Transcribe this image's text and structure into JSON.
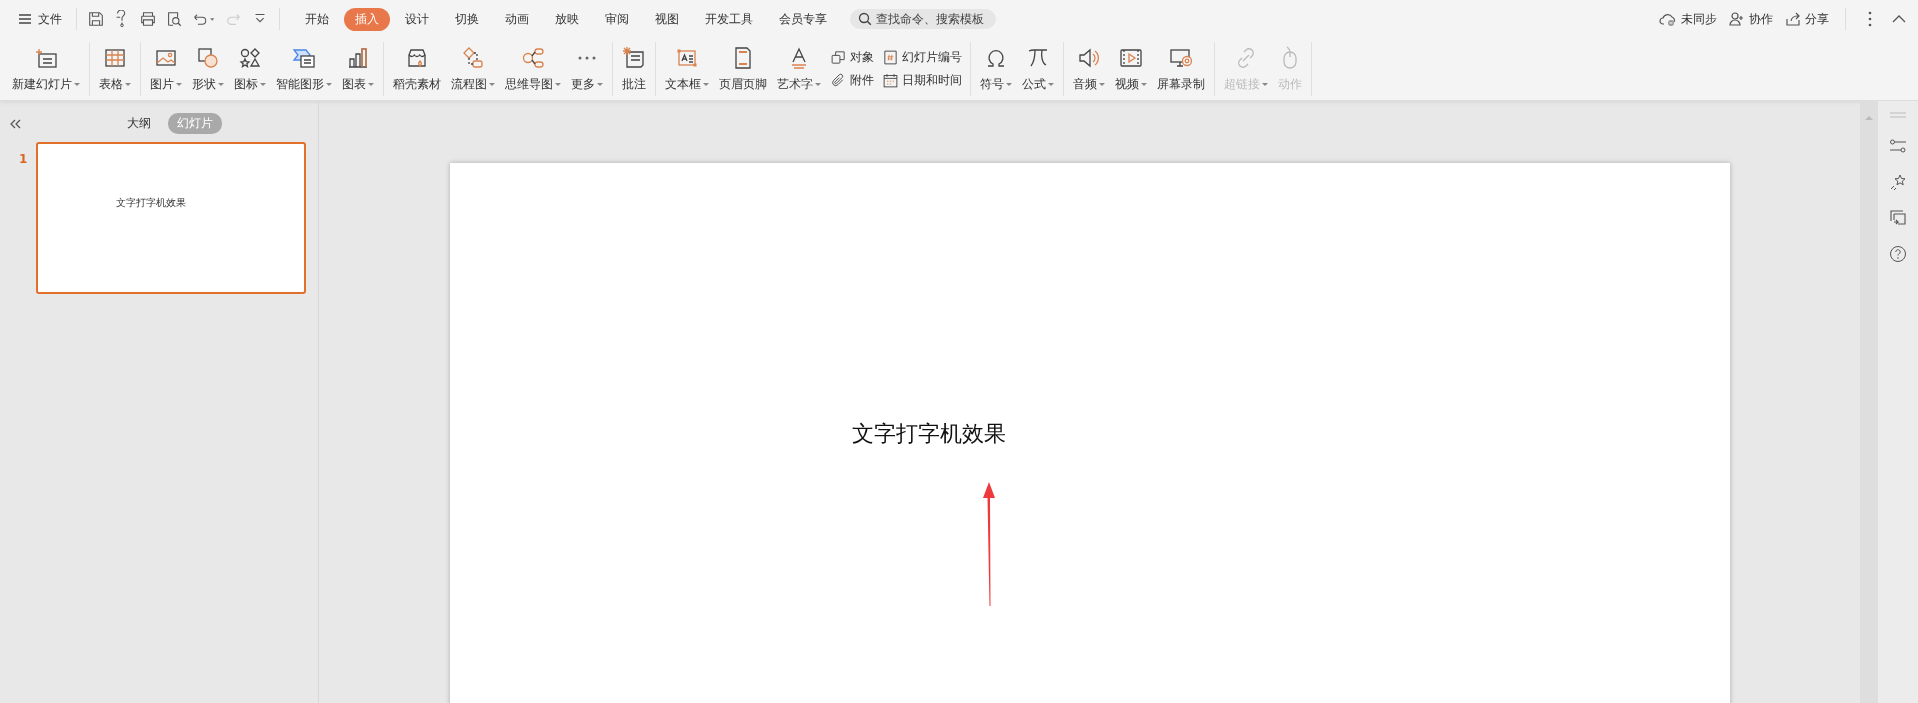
{
  "menu": {
    "label": "文件"
  },
  "tabs": [
    {
      "label": "开始",
      "selected": false
    },
    {
      "label": "插入",
      "selected": true
    },
    {
      "label": "设计",
      "selected": false
    },
    {
      "label": "切换",
      "selected": false
    },
    {
      "label": "动画",
      "selected": false
    },
    {
      "label": "放映",
      "selected": false
    },
    {
      "label": "审阅",
      "selected": false
    },
    {
      "label": "视图",
      "selected": false
    },
    {
      "label": "开发工具",
      "selected": false
    },
    {
      "label": "会员专享",
      "selected": false
    }
  ],
  "search": {
    "placeholder": "查找命令、搜索模板"
  },
  "account_actions": [
    {
      "label": "未同步"
    },
    {
      "label": "协作"
    },
    {
      "label": "分享"
    }
  ],
  "ribbon": {
    "groups": [
      {
        "items": [
          {
            "kind": "large",
            "label": "新建幻灯片",
            "dropdown": true,
            "disabled": false
          }
        ]
      },
      {
        "items": [
          {
            "kind": "large",
            "label": "表格",
            "dropdown": true,
            "disabled": false
          }
        ]
      },
      {
        "items": [
          {
            "kind": "large",
            "label": "图片",
            "dropdown": true,
            "disabled": false
          },
          {
            "kind": "large",
            "label": "形状",
            "dropdown": true,
            "disabled": false
          },
          {
            "kind": "large",
            "label": "图标",
            "dropdown": true,
            "disabled": false
          },
          {
            "kind": "large",
            "label": "智能图形",
            "dropdown": true,
            "disabled": false
          },
          {
            "kind": "large",
            "label": "图表",
            "dropdown": true,
            "disabled": false
          }
        ]
      },
      {
        "items": [
          {
            "kind": "large",
            "label": "稻壳素材",
            "dropdown": false,
            "disabled": false
          },
          {
            "kind": "large",
            "label": "流程图",
            "dropdown": true,
            "disabled": false
          },
          {
            "kind": "large",
            "label": "思维导图",
            "dropdown": true,
            "disabled": false
          },
          {
            "kind": "large",
            "label": "更多",
            "dropdown": true,
            "disabled": false
          }
        ]
      },
      {
        "items": [
          {
            "kind": "large",
            "label": "批注",
            "dropdown": false,
            "disabled": false
          }
        ]
      },
      {
        "items": [
          {
            "kind": "large",
            "label": "文本框",
            "dropdown": true,
            "disabled": false
          },
          {
            "kind": "large",
            "label": "页眉页脚",
            "dropdown": false,
            "disabled": false
          },
          {
            "kind": "large",
            "label": "艺术字",
            "dropdown": true,
            "disabled": false
          },
          {
            "kind": "stack",
            "items": [
              {
                "label": "对象"
              },
              {
                "label": "附件"
              }
            ]
          },
          {
            "kind": "stack",
            "items": [
              {
                "label": "幻灯片编号"
              },
              {
                "label": "日期和时间"
              }
            ]
          }
        ]
      },
      {
        "items": [
          {
            "kind": "large",
            "label": "符号",
            "dropdown": true,
            "disabled": false
          },
          {
            "kind": "large",
            "label": "公式",
            "dropdown": true,
            "disabled": false
          }
        ]
      },
      {
        "items": [
          {
            "kind": "large",
            "label": "音频",
            "dropdown": true,
            "disabled": false
          },
          {
            "kind": "large",
            "label": "视频",
            "dropdown": true,
            "disabled": false
          },
          {
            "kind": "large",
            "label": "屏幕录制",
            "dropdown": false,
            "disabled": false
          }
        ]
      },
      {
        "items": [
          {
            "kind": "large",
            "label": "超链接",
            "dropdown": true,
            "disabled": true
          },
          {
            "kind": "large",
            "label": "动作",
            "dropdown": false,
            "disabled": true
          }
        ]
      }
    ]
  },
  "slide_panel": {
    "tabs": [
      {
        "label": "大纲",
        "selected": false
      },
      {
        "label": "幻灯片",
        "selected": true
      }
    ],
    "slides": [
      {
        "number": "1",
        "title": "文字打字机效果",
        "selected": true
      }
    ]
  },
  "slide": {
    "title": "文字打字机效果"
  }
}
